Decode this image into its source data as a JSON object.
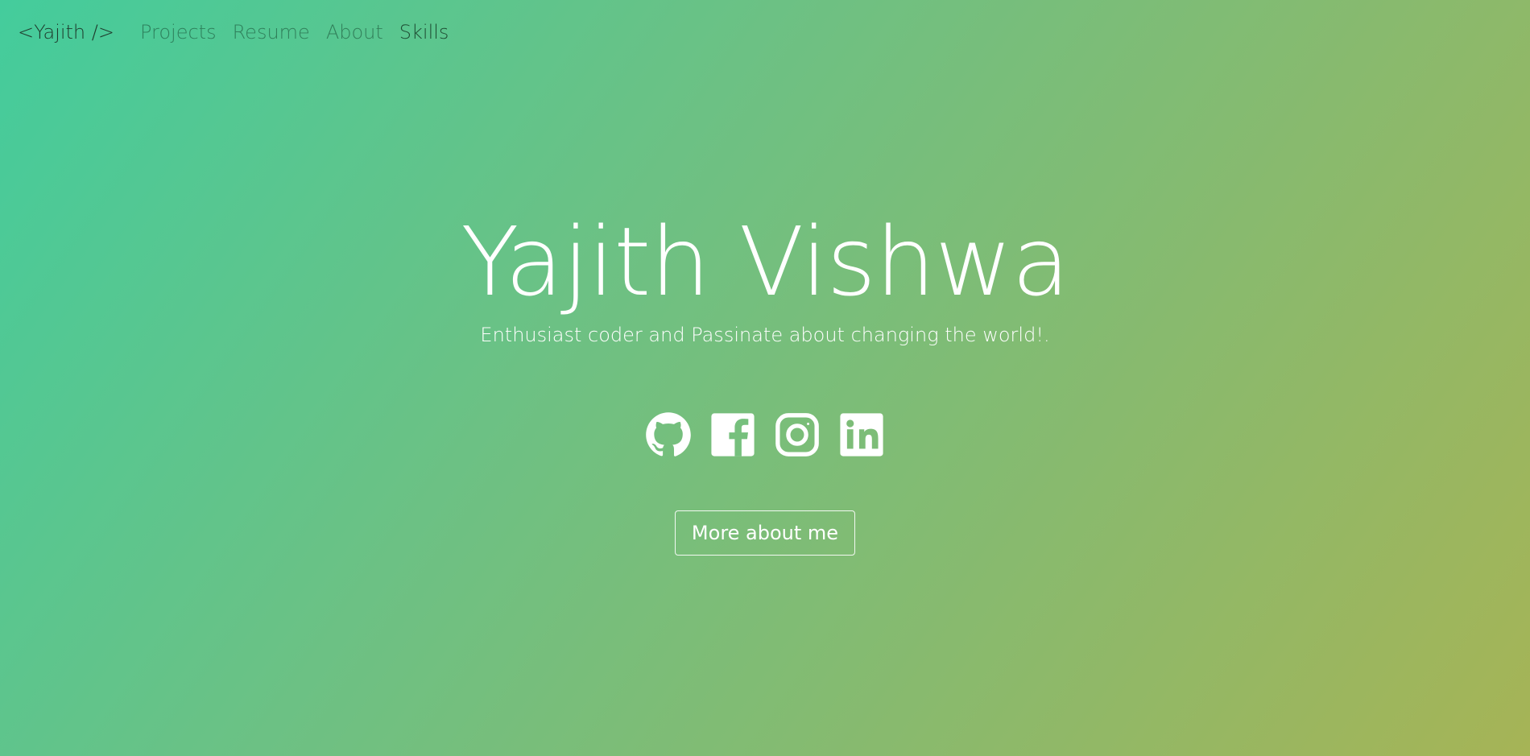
{
  "nav": {
    "brand": "<Yajith />",
    "links": [
      {
        "label": "Projects"
      },
      {
        "label": "Resume"
      },
      {
        "label": "About"
      },
      {
        "label": "Skills"
      }
    ]
  },
  "hero": {
    "name": "Yajith Vishwa",
    "tagline": "Enthusiast coder and Passinate about changing the world!.",
    "cta_label": "More about me"
  },
  "social": [
    {
      "icon": "github-icon"
    },
    {
      "icon": "facebook-icon"
    },
    {
      "icon": "instagram-icon"
    },
    {
      "icon": "linkedin-icon"
    }
  ],
  "colors": {
    "gradient_start": "#44cc9c",
    "gradient_end": "#a6b456",
    "text": "#ffffff"
  }
}
